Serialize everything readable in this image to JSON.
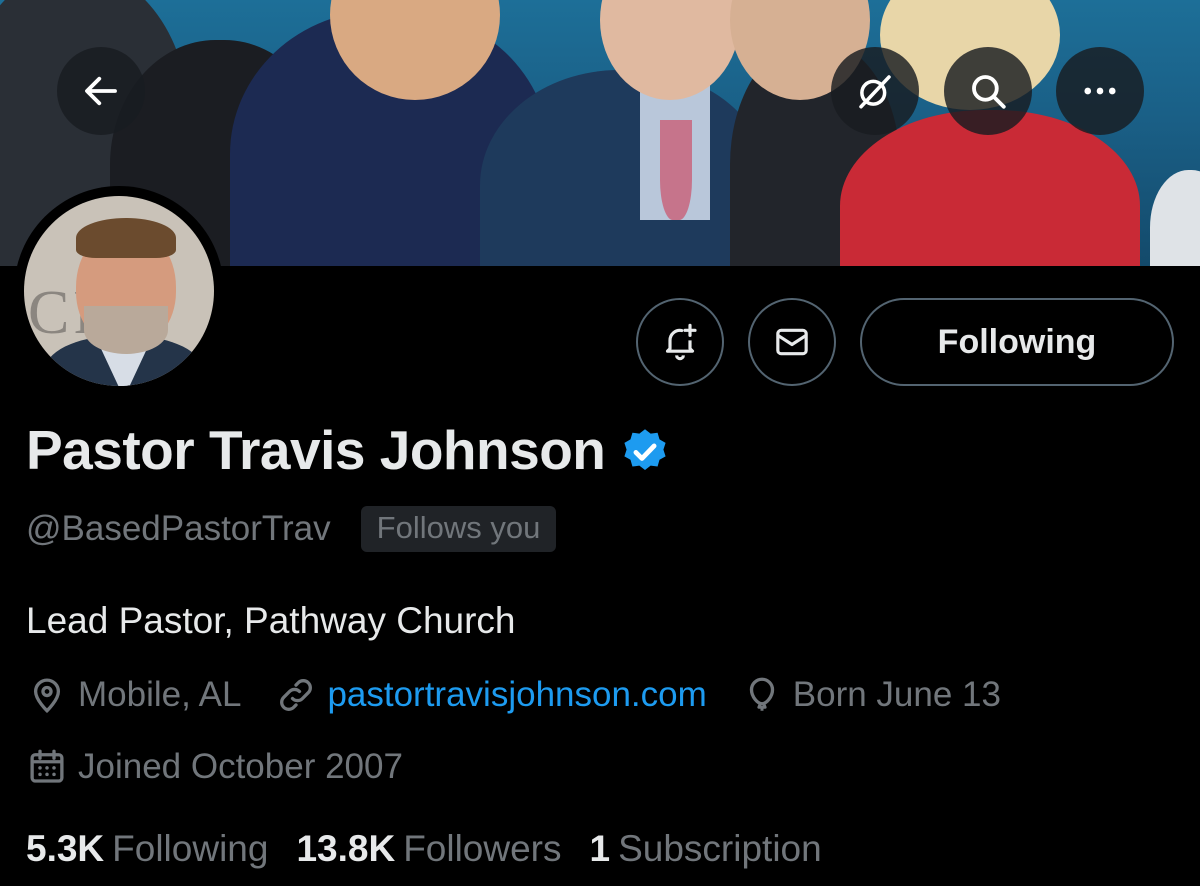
{
  "header": {
    "back_icon": "arrow-left-icon",
    "grok_icon": "slashed-circle-icon",
    "search_icon": "search-icon",
    "more_icon": "more-horizontal-icon"
  },
  "actions": {
    "notify_icon": "bell-plus-icon",
    "message_icon": "envelope-icon",
    "following_label": "Following"
  },
  "profile": {
    "name": "Pastor Travis Johnson",
    "verified_color": "#1d9bf0",
    "handle": "@BasedPastorTrav",
    "follows_you": "Follows you",
    "bio": "Lead Pastor, Pathway Church",
    "location": "Mobile, AL",
    "website": "pastortravisjohnson.com",
    "birthday": "Born June 13",
    "joined": "Joined October 2007"
  },
  "stats": {
    "following_count": "5.3K",
    "following_label": "Following",
    "followers_count": "13.8K",
    "followers_label": "Followers",
    "subscriptions_count": "1",
    "subscriptions_label": "Subscription"
  },
  "colors": {
    "background": "#000000",
    "text_primary": "#e7e9ea",
    "text_secondary": "#71767b",
    "link": "#1d9bf0",
    "border": "#536471"
  }
}
